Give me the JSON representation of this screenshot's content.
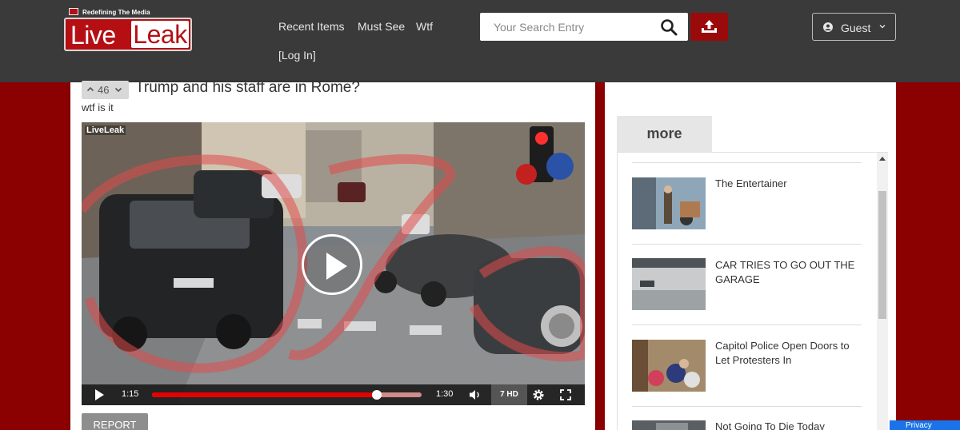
{
  "header": {
    "logo": {
      "tagline": "Redefining The Media",
      "live": "Live",
      "leak": "Leak"
    },
    "nav": [
      {
        "label": "Recent Items"
      },
      {
        "label": "Must See"
      },
      {
        "label": "Wtf"
      },
      {
        "label": "[Log In]"
      }
    ],
    "search": {
      "placeholder": "Your Search Entry",
      "value": ""
    },
    "user": {
      "label": "Guest"
    }
  },
  "post": {
    "votes": "46",
    "title": "Trump and his staff are in Rome?",
    "description": "wtf is it",
    "report_label": "REPORT"
  },
  "player": {
    "watermark": "LiveLeak",
    "current_time": "1:15",
    "duration": "1:30",
    "progress_fraction": 0.833,
    "quality_label": "7 HD"
  },
  "sidebar": {
    "tab_label": "more",
    "items": [
      {
        "title": "The Entertainer"
      },
      {
        "title": "CAR TRIES TO GO OUT THE GARAGE"
      },
      {
        "title": "Capitol Police Open Doors to Let Protesters In"
      },
      {
        "title": "Not Going To Die Today"
      }
    ]
  },
  "privacy_badge": "Privacy",
  "colors": {
    "header_bg": "#3a3a3a",
    "page_bg": "#8b0000",
    "brand_red": "#b50f14",
    "progress_red": "#e60000"
  }
}
